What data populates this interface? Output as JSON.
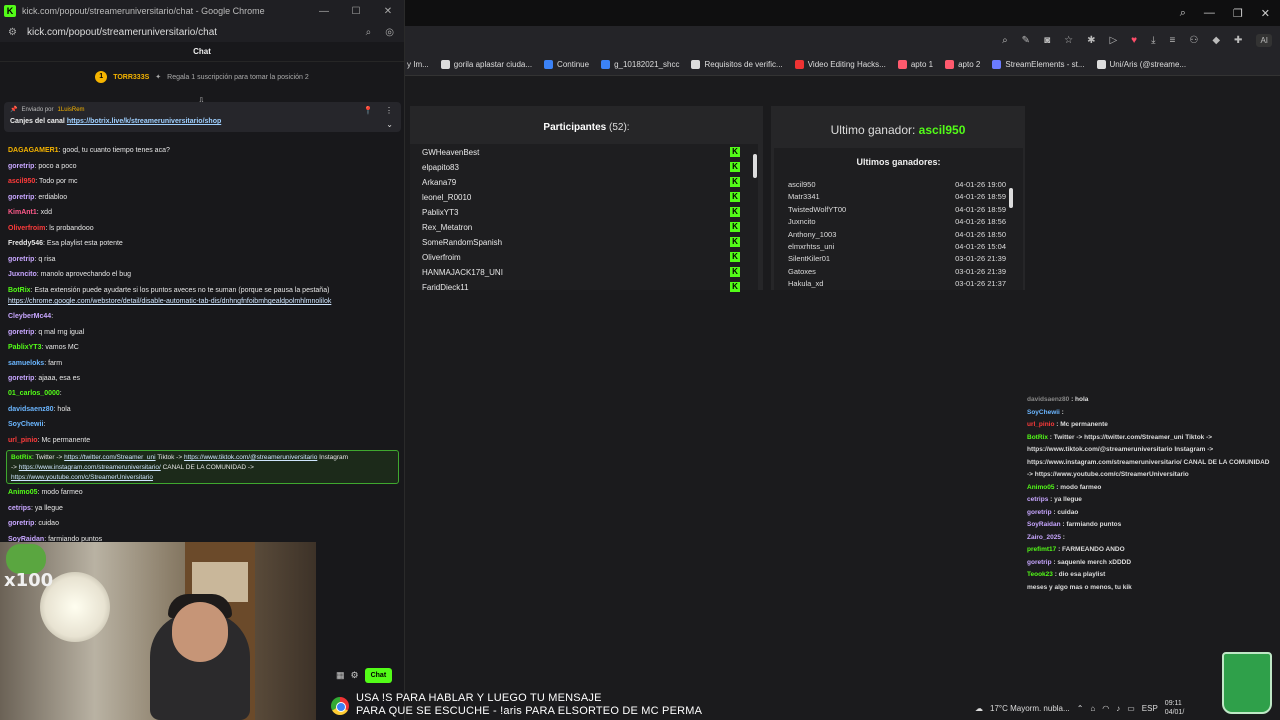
{
  "popout": {
    "window_title": "kick.com/popout/streameruniversitario/chat - Google Chrome",
    "url": "kick.com/popout/streameruniversitario/chat",
    "chat_header": "Chat",
    "pin_user": "TORR333S",
    "pin_text": "Regala 1 suscripción para tomar la posición 2",
    "pinned_sender_label": "Enviado por",
    "pinned_sender": "1LuisRem",
    "pinned_text": "Canjes del canal",
    "pinned_link": "https://botrix.live/k/streameruniversitario/shop",
    "messages": [
      {
        "name": "DAGAGAMER1",
        "color": "#f5b400",
        "text": ": good, tu cuanto tiempo tenes aca?"
      },
      {
        "name": "goretrip",
        "color": "#c7a6ff",
        "text": ": poco a poco"
      },
      {
        "name": "ascil950",
        "color": "#ff3b3b",
        "text": ": Todo por mc"
      },
      {
        "name": "goretrip",
        "color": "#c7a6ff",
        "text": ": erdiabloo"
      },
      {
        "name": "KimAnt1",
        "color": "#ff5a8a",
        "text": ": xdd"
      },
      {
        "name": "Oliverfroim",
        "color": "#ff3b3b",
        "text": ": ls probandooo"
      },
      {
        "name": "Freddy546",
        "color": "#e6e6e6",
        "text": ": Esa playlist esta potente"
      },
      {
        "name": "goretrip",
        "color": "#c7a6ff",
        "text": ": q risa"
      },
      {
        "name": "Juxncito",
        "color": "#c7a6ff",
        "text": ": manolo aprovechando el bug"
      },
      {
        "name": "BotRix",
        "color": "#53fc18",
        "text": ": Esta extensión puede ayudarte si los puntos aveces no te suman (porque se pausa la pestaña)"
      },
      {
        "name": "",
        "color": "#e6e6e6",
        "text": "",
        "link": "https://chrome.google.com/webstore/detail/disable-automatic-tab-dis/dnhngfnfoibmhgealdpolmhlmnolilok"
      },
      {
        "name": "CleyberMc44",
        "color": "#c7a6ff",
        "text": ":"
      },
      {
        "name": "goretrip",
        "color": "#c7a6ff",
        "text": ": q mal rng igual"
      },
      {
        "name": "PablixYT3",
        "color": "#53fc18",
        "text": ": vamos MC"
      },
      {
        "name": "samueloks",
        "color": "#6bb6ff",
        "text": ": farm"
      },
      {
        "name": "goretrip",
        "color": "#c7a6ff",
        "text": ": ajaaa, esa es"
      },
      {
        "name": "01_carlos_0000",
        "color": "#53fc18",
        "text": ":"
      },
      {
        "name": "davidsaenz80",
        "color": "#6bb6ff",
        "text": ": hola"
      },
      {
        "name": "SoyChewii",
        "color": "#6bb6ff",
        "text": ":"
      },
      {
        "name": "url_pinio",
        "color": "#ff3b3b",
        "text": ": Mc permanente"
      }
    ],
    "botbox": {
      "name": "BotRix",
      "t1": ": Twitter ->",
      "l1": "https://twitter.com/Streamer_uni",
      "t2": "Tiktok ->",
      "l2": "https://www.tiktok.com/@streameruniversitario",
      "t3": "Instagram",
      "t4": "->",
      "l3": "https://www.instagram.com/streameruniversitario/",
      "t5": "CANAL DE LA COMUNIDAD ->",
      "l4": "https://www.youtube.com/c/StreamerUniversitario"
    },
    "messages2": [
      {
        "name": "Animo05",
        "color": "#53fc18",
        "text": ": modo farmeo"
      },
      {
        "name": "cetrips",
        "color": "#c7a6ff",
        "text": ": ya llegue"
      },
      {
        "name": "goretrip",
        "color": "#c7a6ff",
        "text": ": cuidao"
      },
      {
        "name": "SoyRaidan",
        "color": "#c7a6ff",
        "text": ": farmiando puntos"
      }
    ],
    "cam_badge": "x100",
    "chat_button": "Chat"
  },
  "main": {
    "bookmarks": [
      {
        "label": "y Im...",
        "color": "#888"
      },
      {
        "label": "gorila aplastar ciuda...",
        "color": "#ddd"
      },
      {
        "label": "Continue",
        "color": "#3b82f6"
      },
      {
        "label": "g_10182021_shcc",
        "color": "#3b82f6"
      },
      {
        "label": "Requisitos de verific...",
        "color": "#ddd"
      },
      {
        "label": "Video Editing Hacks...",
        "color": "#e33"
      },
      {
        "label": "apto 1",
        "color": "#ff5a6e"
      },
      {
        "label": "apto 2",
        "color": "#ff5a6e"
      },
      {
        "label": "StreamElements - st...",
        "color": "#6b7bff"
      },
      {
        "label": "Uni/Aris (@streame...",
        "color": "#ddd"
      }
    ],
    "ai_label": "AI",
    "participants_title": "Participantes",
    "participants_count": "(52):",
    "participants": [
      "GWHeavenBest",
      "elpapito83",
      "Arkana79",
      "leonel_R0010",
      "PablixYT3",
      "Rex_Metatron",
      "SomeRandomSpanish",
      "Oliverfroim",
      "HANMAJACK178_UNI",
      "FaridDieck11"
    ],
    "last_winner_label": "Ultimo ganador:",
    "last_winner": "ascil950",
    "winners_title": "Ultimos ganadores:",
    "winners": [
      {
        "name": "ascil950",
        "date": "04-01-26 19:00"
      },
      {
        "name": "Matr3341",
        "date": "04-01-26 18:59"
      },
      {
        "name": "TwistedWolfYT00",
        "date": "04-01-26 18:59"
      },
      {
        "name": "Juxncito",
        "date": "04-01-26 18:56"
      },
      {
        "name": "Anthony_1003",
        "date": "04-01-26 18:50"
      },
      {
        "name": "elmxrhtss_uni",
        "date": "04-01-26 15:04"
      },
      {
        "name": "SilentKiler01",
        "date": "03-01-26 21:39"
      },
      {
        "name": "Gatoxes",
        "date": "03-01-26 21:39"
      },
      {
        "name": "Hakula_xd",
        "date": "03-01-26 21:37"
      }
    ],
    "overlay": [
      {
        "name": "davidsaenz80",
        "color": "#888",
        "text": " : hola"
      },
      {
        "name": "SoyChewii",
        "color": "#6bb6ff",
        "text": " :"
      },
      {
        "name": "url_pinio",
        "color": "#ff3b3b",
        "text": " : Mc permanente"
      },
      {
        "name": "BotRix",
        "color": "#53fc18",
        "text": " : Twitter -> https://twitter.com/Streamer_uni Tiktok ->"
      },
      {
        "name": "",
        "color": "#ddd",
        "text": "https://www.tiktok.com/@streameruniversitario Instagram ->"
      },
      {
        "name": "",
        "color": "#ddd",
        "text": "https://www.instagram.com/streameruniversitario/ CANAL DE LA COMUNIDAD"
      },
      {
        "name": "",
        "color": "#ddd",
        "text": "-> https://www.youtube.com/c/StreamerUniversitario"
      },
      {
        "name": "Animo05",
        "color": "#53fc18",
        "text": " : modo farmeo"
      },
      {
        "name": "cetrips",
        "color": "#c7a6ff",
        "text": " : ya llegue"
      },
      {
        "name": "goretrip",
        "color": "#c7a6ff",
        "text": " : cuidao"
      },
      {
        "name": "SoyRaidan",
        "color": "#c7a6ff",
        "text": " : farmiando puntos"
      },
      {
        "name": "Zairo_2025",
        "color": "#c7a6ff",
        "text": " :"
      },
      {
        "name": "prefimt17",
        "color": "#53fc18",
        "text": " : FARMEANDO ANDO"
      },
      {
        "name": "goretrip",
        "color": "#c7a6ff",
        "text": " : saquenle merch xDDDD"
      },
      {
        "name": "Teook23",
        "color": "#53fc18",
        "text": " : dio esa playlist"
      },
      {
        "name": "",
        "color": "#ddd",
        "text": "meses y algo mas o menos, tu kik"
      }
    ],
    "subtitle_1": "USA !S PARA HABLAR Y LUEGO TU MENSAJE",
    "subtitle_2": "PARA QUE SE ESCUCHE - !aris PARA ELSORTEO DE MC PERMA",
    "weather": "17°C  Mayorm. nubla...",
    "lang": "ESP",
    "time": "09:11",
    "date": "04/01/"
  }
}
